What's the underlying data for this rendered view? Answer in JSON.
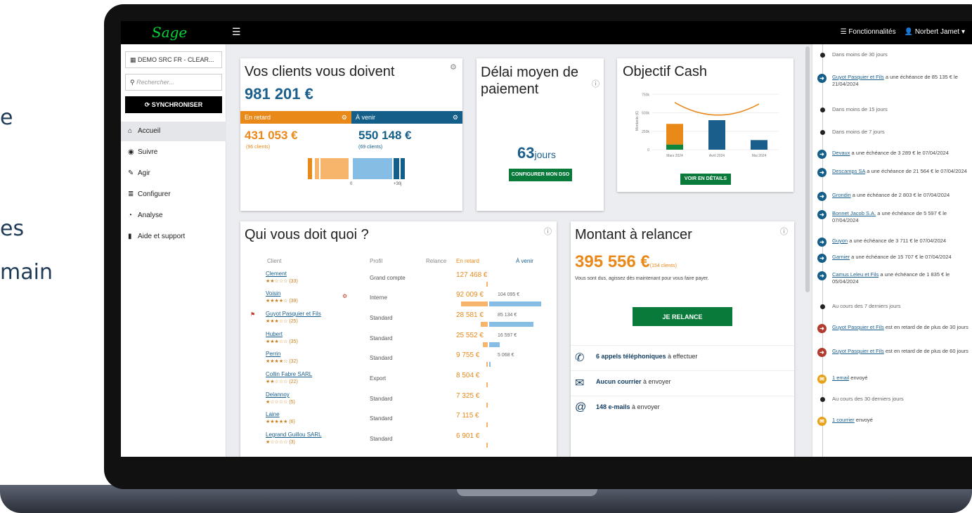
{
  "slide": {
    "frag1": "e",
    "frag2": "es",
    "frag3": "main"
  },
  "app": {
    "logo": "Sage",
    "menu_icon": "hamburger-icon",
    "features_label": "Fonctionnalités",
    "user_label": "Norbert Jamet"
  },
  "sidebar": {
    "company": "DEMO SRC FR - CLEAR...",
    "search_placeholder": "Rechercher...",
    "sync_label": "SYNCHRONISER",
    "items": [
      {
        "label": "Accueil",
        "icon": "home-icon"
      },
      {
        "label": "Suivre",
        "icon": "gauge-icon"
      },
      {
        "label": "Agir",
        "icon": "edit-icon"
      },
      {
        "label": "Configurer",
        "icon": "sliders-icon"
      },
      {
        "label": "Analyse",
        "icon": "pie-icon"
      },
      {
        "label": "Aide et support",
        "icon": "book-icon"
      }
    ]
  },
  "owed": {
    "title": "Vos clients vous doivent",
    "total": "981 201 €",
    "late_label": "En retard",
    "ahead_label": "À venir",
    "late_amount": "431 053 €",
    "late_clients": "(96 clients)",
    "ahead_amount": "550 148 €",
    "ahead_clients": "(69 clients)",
    "axis_zero": "0",
    "axis_30": "+30j"
  },
  "dso": {
    "title": "Délai moyen de paiement",
    "value": "63",
    "unit": "jours",
    "button": "CONFIGURER MON DSO"
  },
  "cash": {
    "title": "Objectif Cash",
    "button": "VOIR EN DÉTAILS",
    "chart_data": {
      "type": "bar",
      "categories": [
        "Mars 2024",
        "Avril 2024",
        "Mai 2024"
      ],
      "ylabel": "Montants (€)",
      "yticks": [
        "750k",
        "500k",
        "250k",
        "0"
      ],
      "ylim": [
        0,
        800000
      ],
      "series": [
        {
          "values": [
            70000,
            0,
            0
          ],
          "color": "#10853b"
        },
        {
          "values": [
            280000,
            0,
            0
          ],
          "color": "#e8891a"
        },
        {
          "values": [
            0,
            400000,
            130000
          ],
          "color": "#1a5f8c"
        }
      ],
      "objective_line": [
        640000,
        480000,
        620000
      ]
    }
  },
  "who": {
    "title": "Qui vous doit quoi ?",
    "headers": [
      "Client",
      "Profil",
      "Relance",
      "En retard",
      "À venir"
    ],
    "rows": [
      {
        "name": "Clement",
        "stars": "★★☆☆☆ (33)",
        "profile": "Grand compte",
        "late": "127 468 €",
        "ahead": "",
        "late_frac": 0.0,
        "ahead_frac": 0.0
      },
      {
        "name": "Voisin",
        "stars": "★★★★☆ (39)",
        "profile": "Interne",
        "late": "92 009 €",
        "ahead": "104 095 €",
        "late_frac": 0.8,
        "ahead_frac": 1.0
      },
      {
        "name": "Guyot Pasquier et Fils",
        "stars": "★★★☆☆ (25)",
        "profile": "Standard",
        "late": "28 581 €",
        "ahead": "85 134 €",
        "late_frac": 0.2,
        "ahead_frac": 0.85
      },
      {
        "name": "Hubert",
        "stars": "★★★☆☆ (35)",
        "profile": "Standard",
        "late": "25 552 €",
        "ahead": "16 597 €",
        "late_frac": 0.15,
        "ahead_frac": 0.2
      },
      {
        "name": "Perrin",
        "stars": "★★★★☆ (32)",
        "profile": "Standard",
        "late": "9 755 €",
        "ahead": "5 068 €",
        "late_frac": 0.04,
        "ahead_frac": 0.03
      },
      {
        "name": "Collin Fabre SARL",
        "stars": "★★☆☆☆ (22)",
        "profile": "Export",
        "late": "8 504 €",
        "ahead": "",
        "late_frac": 0.03,
        "ahead_frac": 0.0
      },
      {
        "name": "Delannoy",
        "stars": "★☆☆☆☆ (5)",
        "profile": "Standard",
        "late": "7 325 €",
        "ahead": "",
        "late_frac": 0.02,
        "ahead_frac": 0.0
      },
      {
        "name": "Laine",
        "stars": "★★★★★ (6)",
        "profile": "Standard",
        "late": "7 115 €",
        "ahead": "",
        "late_frac": 0.02,
        "ahead_frac": 0.0
      },
      {
        "name": "Legrand Guillou SARL",
        "stars": "★☆☆☆☆ (3)",
        "profile": "Standard",
        "late": "6 901 €",
        "ahead": "",
        "late_frac": 0.02,
        "ahead_frac": 0.0
      }
    ]
  },
  "relance": {
    "title": "Montant à relancer",
    "amount": "395 556 €",
    "clients": "(154 clients)",
    "subtitle": "Vous sont dus, agissez dès maintenant pour vous faire payer.",
    "button": "JE RELANCE",
    "actions": [
      {
        "bold": "6 appels téléphoniques",
        "rest": " à effectuer",
        "icon": "phone-icon"
      },
      {
        "bold": "Aucun courrier",
        "rest": " à envoyer",
        "icon": "envelope-icon"
      },
      {
        "bold": "148 e-mails",
        "rest": " à envoyer",
        "icon": "at-icon"
      }
    ]
  },
  "timeline": {
    "items": [
      {
        "kind": "header",
        "text": "Dans moins de 30 jours"
      },
      {
        "kind": "event",
        "link": "Guyot Pasquier et Fils",
        "text": " a une échéance de 85 135 € le 21/04/2024"
      },
      {
        "kind": "header",
        "text": "Dans moins de 15 jours"
      },
      {
        "kind": "header",
        "text": "Dans moins de 7 jours"
      },
      {
        "kind": "event",
        "link": "Devaux",
        "text": " a une échéance de 3 289 € le 07/04/2024"
      },
      {
        "kind": "event",
        "link": "Descamps SA",
        "text": " a une échéance de 21 564 € le 07/04/2024"
      },
      {
        "kind": "event",
        "link": "Grondin",
        "text": " a une échéance de 2 803 € le 07/04/2024"
      },
      {
        "kind": "event",
        "link": "Bonnet Jacob S.A.",
        "text": " a une échéance de 5 597 € le 07/04/2024"
      },
      {
        "kind": "event",
        "link": "Guyon",
        "text": " a une échéance de 3 711 € le 07/04/2024"
      },
      {
        "kind": "event",
        "link": "Garnier",
        "text": " a une échéance de 15 707 € le 07/04/2024"
      },
      {
        "kind": "event",
        "link": "Camus Leleu et Fils",
        "text": " a une échéance de 1 835 € le 05/04/2024"
      },
      {
        "kind": "header",
        "text": "Au cours des 7 derniers jours"
      },
      {
        "kind": "late",
        "link": "Guyot Pasquier et Fils",
        "text": " est en retard de de plus de 30 jours"
      },
      {
        "kind": "late",
        "link": "Guyot Pasquier et Fils",
        "text": " est en retard de de plus de 60 jours"
      },
      {
        "kind": "mail",
        "link": "1 email",
        "text": " envoyé"
      },
      {
        "kind": "header",
        "text": "Au cours des 30 derniers jours"
      },
      {
        "kind": "mail",
        "link": "1 courrier",
        "text": " envoyé"
      }
    ]
  }
}
